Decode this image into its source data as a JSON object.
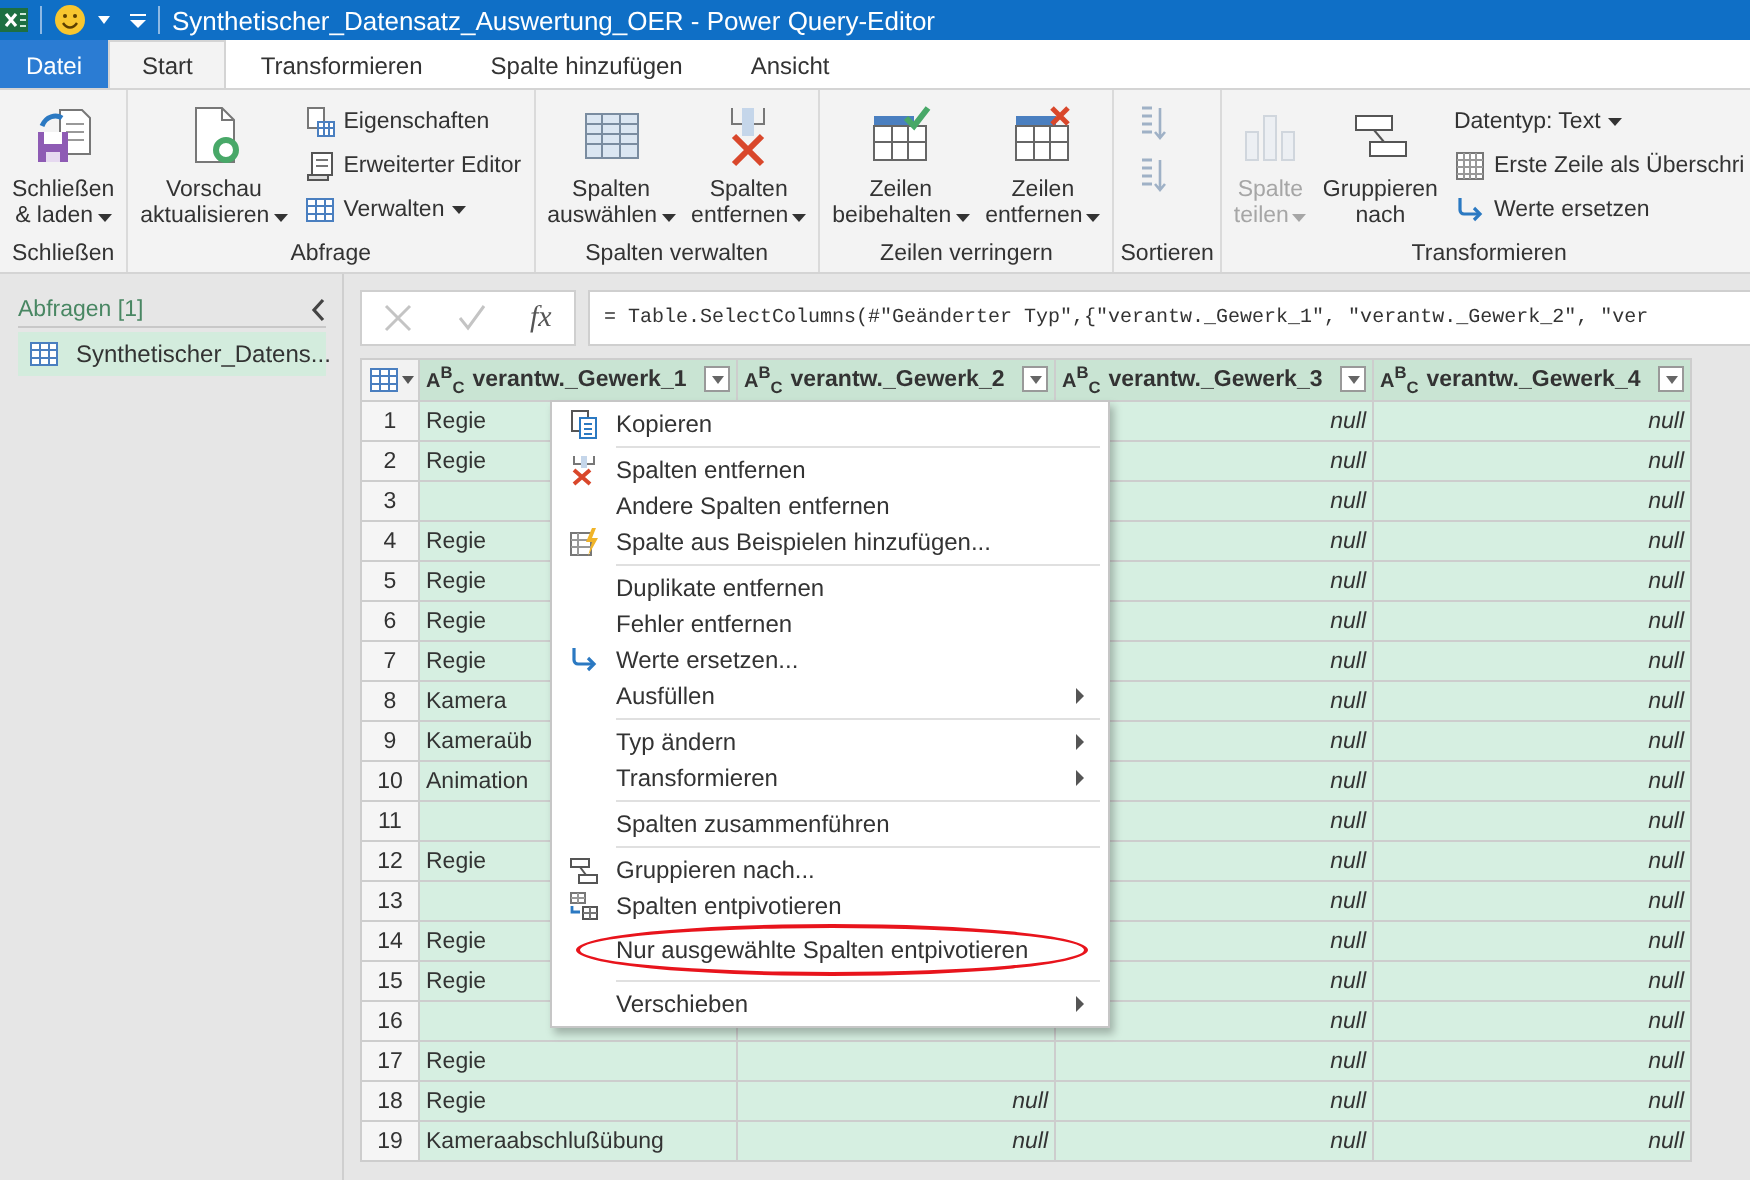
{
  "window": {
    "title": "Synthetischer_Datensatz_Auswertung_OER - Power Query-Editor"
  },
  "tabs": [
    {
      "label": "Datei",
      "kind": "file",
      "selected": false
    },
    {
      "label": "Start",
      "kind": "tab",
      "selected": true
    },
    {
      "label": "Transformieren",
      "kind": "tab",
      "selected": false
    },
    {
      "label": "Spalte hinzufügen",
      "kind": "tab",
      "selected": false
    },
    {
      "label": "Ansicht",
      "kind": "tab",
      "selected": false
    }
  ],
  "ribbon": {
    "groups": [
      {
        "label": "Schließen",
        "items": [
          {
            "kind": "large",
            "lines": [
              "Schließen",
              "& laden"
            ],
            "dropdown": true,
            "disabled": false
          }
        ]
      },
      {
        "label": "Abfrage",
        "items": [
          {
            "kind": "large",
            "lines": [
              "Vorschau",
              "aktualisieren"
            ],
            "dropdown": true,
            "disabled": false
          },
          {
            "kind": "stack",
            "entries": [
              {
                "label": "Eigenschaften",
                "dropdown": false
              },
              {
                "label": "Erweiterter Editor",
                "dropdown": false
              },
              {
                "label": "Verwalten",
                "dropdown": true
              }
            ]
          }
        ]
      },
      {
        "label": "Spalten verwalten",
        "items": [
          {
            "kind": "large",
            "lines": [
              "Spalten",
              "auswählen"
            ],
            "dropdown": true,
            "disabled": false
          },
          {
            "kind": "large",
            "lines": [
              "Spalten",
              "entfernen"
            ],
            "dropdown": true,
            "disabled": false
          }
        ]
      },
      {
        "label": "Zeilen verringern",
        "items": [
          {
            "kind": "large",
            "lines": [
              "Zeilen",
              "beibehalten"
            ],
            "dropdown": true,
            "disabled": false
          },
          {
            "kind": "large",
            "lines": [
              "Zeilen",
              "entfernen"
            ],
            "dropdown": true,
            "disabled": false
          }
        ]
      },
      {
        "label": "Sortieren",
        "items": [
          {
            "kind": "sort"
          }
        ]
      },
      {
        "label": "Transformieren",
        "items": [
          {
            "kind": "large",
            "lines": [
              "Spalte",
              "teilen"
            ],
            "dropdown": true,
            "disabled": true
          },
          {
            "kind": "large",
            "lines": [
              "Gruppieren",
              "nach"
            ],
            "dropdown": false,
            "disabled": false
          },
          {
            "kind": "stack",
            "entries": [
              {
                "label": "Datentyp: Text",
                "dropdown": true
              },
              {
                "label": "Erste Zeile als Überschri",
                "dropdown": false
              },
              {
                "label": "Werte ersetzen",
                "dropdown": false
              }
            ]
          }
        ]
      }
    ]
  },
  "sidebar": {
    "title": "Abfragen [1]",
    "items": [
      {
        "label": "Synthetischer_Datens...",
        "selected": true
      }
    ]
  },
  "formula_bar": {
    "function_label": "fx",
    "text": "= Table.SelectColumns(#\"Geänderter Typ\",{\"verantw._Gewerk_1\", \"verantw._Gewerk_2\", \"ver"
  },
  "table": {
    "columns": [
      {
        "type": "A$^{B}$$_{C}$",
        "label": "verantw._Gewerk_1"
      },
      {
        "type": "A$^{B}$$_{C}$",
        "label": "verantw._Gewerk_2"
      },
      {
        "type": "A$^{B}$$_{C}$",
        "label": "verantw._Gewerk_3"
      },
      {
        "type": "A$^{B}$$_{C}$",
        "label": "verantw._Gewerk_4"
      }
    ],
    "rows": [
      {
        "number": "1",
        "cells": [
          "Regie",
          null,
          "null",
          "null"
        ]
      },
      {
        "number": "2",
        "cells": [
          "Regie",
          null,
          "null",
          "null"
        ]
      },
      {
        "number": "3",
        "cells": [
          null,
          null,
          "null",
          "null"
        ]
      },
      {
        "number": "4",
        "cells": [
          "Regie",
          null,
          "null",
          "null"
        ]
      },
      {
        "number": "5",
        "cells": [
          "Regie",
          null,
          "null",
          "null"
        ]
      },
      {
        "number": "6",
        "cells": [
          "Regie",
          null,
          "null",
          "null"
        ]
      },
      {
        "number": "7",
        "cells": [
          "Regie",
          null,
          "null",
          "null"
        ]
      },
      {
        "number": "8",
        "cells": [
          "Kamera",
          null,
          "null",
          "null"
        ]
      },
      {
        "number": "9",
        "cells": [
          "Kameraüb",
          null,
          "null",
          "null"
        ]
      },
      {
        "number": "10",
        "cells": [
          "Animation",
          null,
          "null",
          "null"
        ]
      },
      {
        "number": "11",
        "cells": [
          null,
          null,
          "null",
          "null"
        ]
      },
      {
        "number": "12",
        "cells": [
          "Regie",
          null,
          "null",
          "null"
        ]
      },
      {
        "number": "13",
        "cells": [
          null,
          null,
          "null",
          "null"
        ]
      },
      {
        "number": "14",
        "cells": [
          "Regie",
          null,
          "null",
          "null"
        ]
      },
      {
        "number": "15",
        "cells": [
          "Regie",
          null,
          "null",
          "null"
        ]
      },
      {
        "number": "16",
        "cells": [
          null,
          null,
          "null",
          "null"
        ]
      },
      {
        "number": "17",
        "cells": [
          "Regie",
          null,
          "null",
          "null"
        ]
      },
      {
        "number": "18",
        "cells": [
          "Regie",
          "null",
          "null",
          "null"
        ]
      },
      {
        "number": "19",
        "cells": [
          "Kameraabschlußübung",
          "null",
          "null",
          "null"
        ]
      }
    ]
  },
  "context_menu": {
    "groups": [
      [
        {
          "label": "Kopieren",
          "submenu": false,
          "highlighted": false
        }
      ],
      [
        {
          "label": "Spalten entfernen",
          "submenu": false,
          "highlighted": false
        },
        {
          "label": "Andere Spalten entfernen",
          "submenu": false,
          "highlighted": false
        },
        {
          "label": "Spalte aus Beispielen hinzufügen...",
          "submenu": false,
          "highlighted": false
        }
      ],
      [
        {
          "label": "Duplikate entfernen",
          "submenu": false,
          "highlighted": false
        },
        {
          "label": "Fehler entfernen",
          "submenu": false,
          "highlighted": false
        },
        {
          "label": "Werte ersetzen...",
          "submenu": false,
          "highlighted": false
        },
        {
          "label": "Ausfüllen",
          "submenu": true,
          "highlighted": false
        }
      ],
      [
        {
          "label": "Typ ändern",
          "submenu": true,
          "highlighted": false
        },
        {
          "label": "Transformieren",
          "submenu": true,
          "highlighted": false
        }
      ],
      [
        {
          "label": "Spalten zusammenführen",
          "submenu": false,
          "highlighted": false
        }
      ],
      [
        {
          "label": "Gruppieren nach...",
          "submenu": false,
          "highlighted": false
        },
        {
          "label": "Spalten entpivotieren",
          "submenu": false,
          "highlighted": false
        },
        {
          "label": "Nur ausgewählte Spalten entpivotieren",
          "submenu": false,
          "highlighted": true
        }
      ],
      [
        {
          "label": "Verschieben",
          "submenu": true,
          "highlighted": false
        }
      ]
    ]
  }
}
